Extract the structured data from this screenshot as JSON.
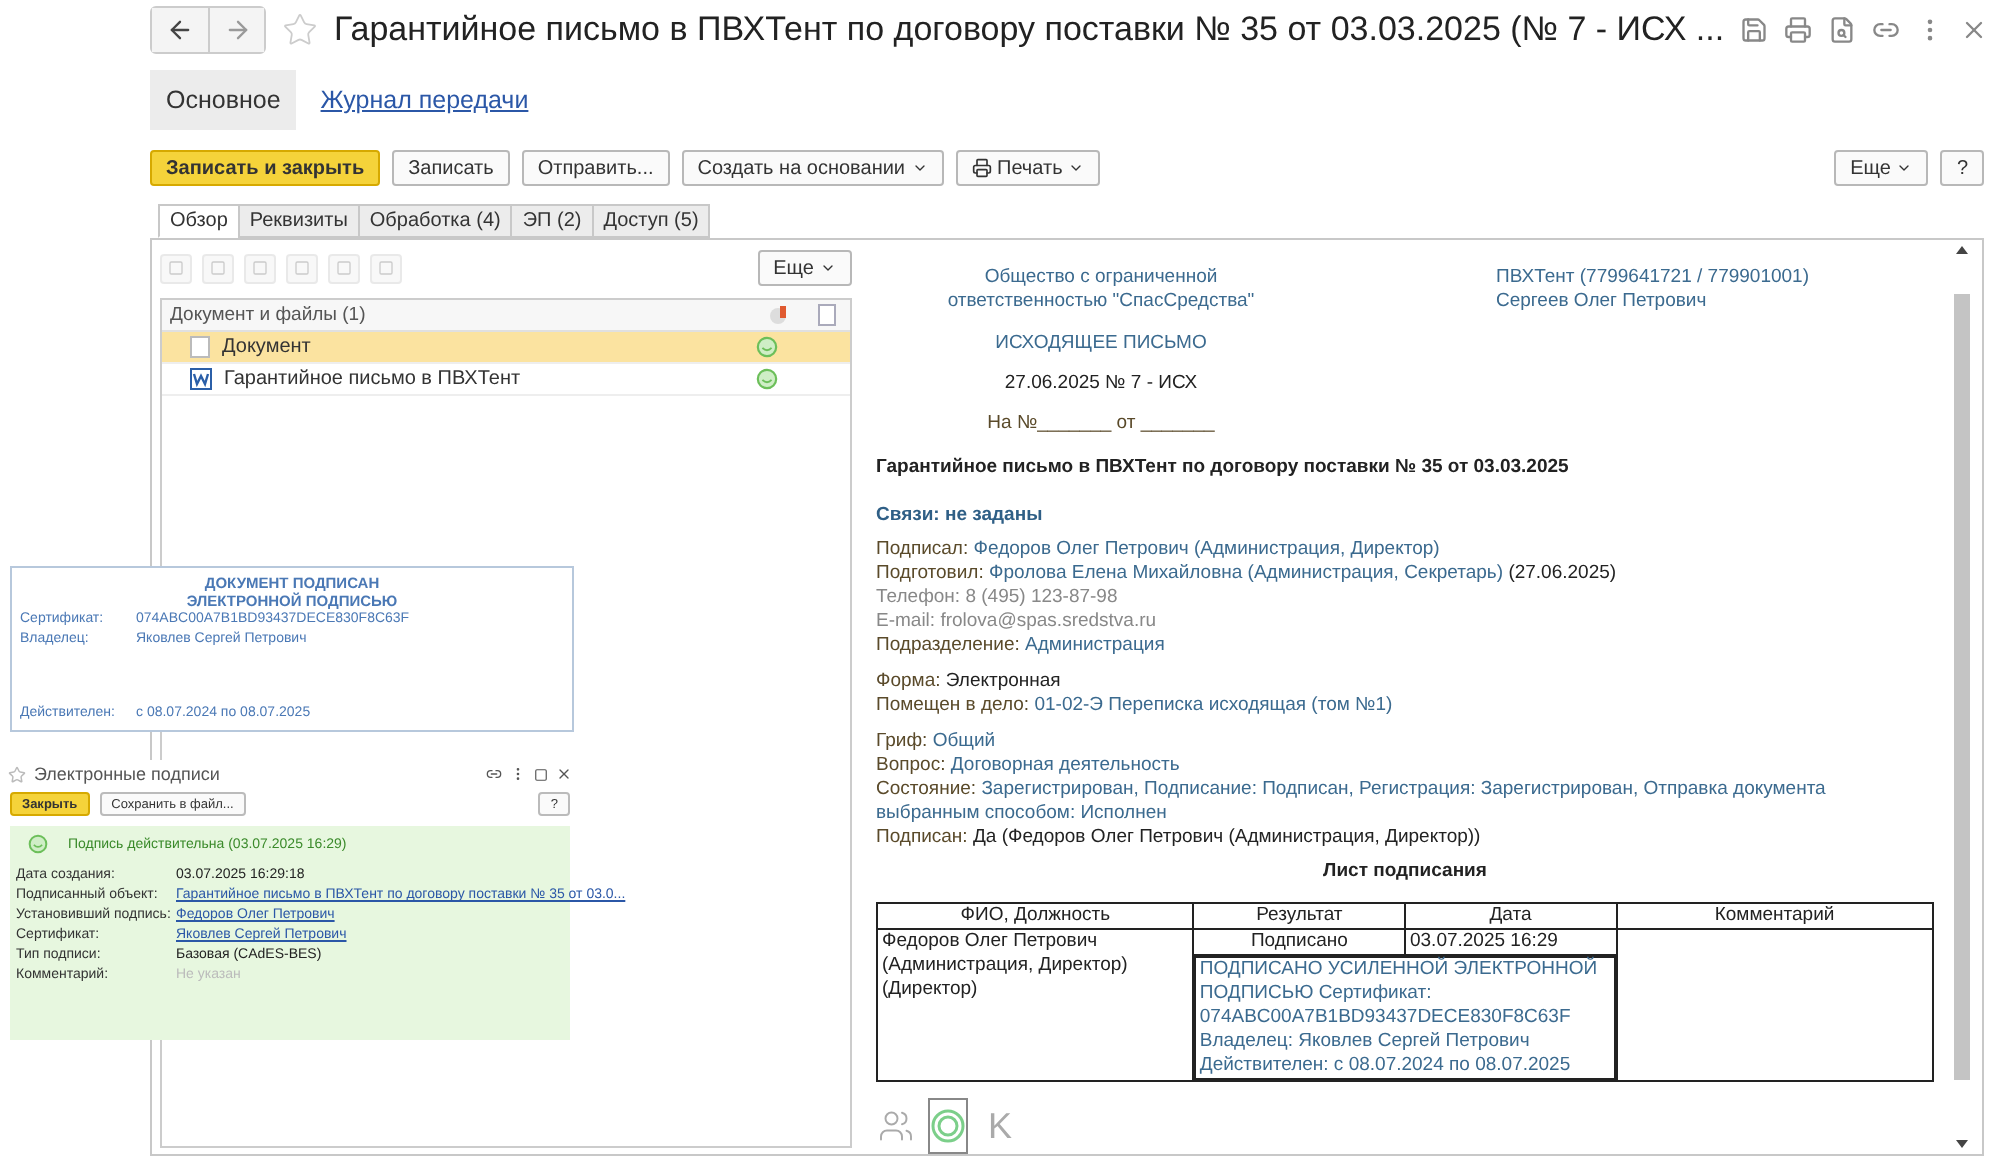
{
  "window": {
    "title": "Гарантийное письмо в ПВХТент по договору поставки № 35 от 03.03.2025 (№ 7 - ИСХ ..."
  },
  "sections": [
    {
      "label": "Основное",
      "selected": true
    },
    {
      "label": "Журнал передачи",
      "selected": false
    }
  ],
  "toolbar": {
    "buttons": [
      {
        "label": "Записать и закрыть",
        "primary": true,
        "dropdown": false,
        "kind": "text"
      },
      {
        "label": "Записать",
        "primary": false,
        "dropdown": false,
        "kind": "text"
      },
      {
        "label": "Отправить...",
        "primary": false,
        "dropdown": false,
        "kind": "text"
      },
      {
        "label": "Создать на основании",
        "primary": false,
        "dropdown": true,
        "kind": "text"
      },
      {
        "label": "Печать",
        "primary": false,
        "dropdown": true,
        "kind": "print"
      }
    ],
    "more": "Еще",
    "help": "?"
  },
  "tabs": [
    {
      "label": "Обзор",
      "selected": true
    },
    {
      "label": "Реквизиты",
      "selected": false
    },
    {
      "label": "Обработка (4)",
      "selected": false
    },
    {
      "label": "ЭП (2)",
      "selected": false
    },
    {
      "label": "Доступ (5)",
      "selected": false
    }
  ],
  "files": {
    "tools_disabled": true,
    "more": "Еще",
    "header": "Документ и файлы (1)",
    "rows": [
      {
        "label": "Документ",
        "kind": "document",
        "selected": true
      },
      {
        "label": "Гарантийное письмо в ПВХТент",
        "kind": "word",
        "selected": false
      }
    ]
  },
  "letter": {
    "sender": [
      "Общество с ограниченной",
      "ответственностью \"СпасСредства\""
    ],
    "recipient": [
      "ПВХТент (7799641721 / 779901001)",
      "Сергеев Олег Петрович"
    ],
    "kind_label": "ИСХОДЯЩЕЕ ПИСЬМО",
    "number": "27.06.2025 № 7 - ИСХ",
    "reply_to": "На №_______ от _______",
    "subject": "Гарантийное письмо в ПВХТент по договору поставки № 35 от 03.03.2025",
    "links_header": "Связи: не заданы",
    "groups": [
      [
        {
          "label": "Подписал:",
          "value": "Федоров Олег Петрович (Администрация, Директор)",
          "kind": "link"
        },
        {
          "label": "Подготовил:",
          "value": "Фролова Елена Михайловна (Администрация, Секретарь)",
          "suffix": "(27.06.2025)",
          "kind": "link"
        },
        {
          "label": "Телефон:",
          "value": "8 (495) 123-87-98",
          "kind": "muted"
        },
        {
          "label": "E-mail:",
          "value": "frolova@spas.sredstva.ru",
          "kind": "muted"
        },
        {
          "label": "Подразделение:",
          "value": "Администрация",
          "kind": "link"
        }
      ],
      [
        {
          "label": "Форма:",
          "value": "Электронная",
          "kind": "plain"
        },
        {
          "label": "Помещен в дело:",
          "value": "01-02-Э Переписка исходящая (том №1)",
          "kind": "link"
        }
      ],
      [
        {
          "label": "Гриф:",
          "value": "Общий",
          "kind": "link"
        },
        {
          "label": "Вопрос:",
          "value": "Договорная деятельность",
          "kind": "link"
        },
        {
          "label": "Состояние:",
          "value": "Зарегистрирован, Подписание: Подписан, Регистрация: Зарегистрирован, Отправка документа выбранным способом: Исполнен",
          "kind": "link"
        },
        {
          "label": "Подписан:",
          "value": "Да (Федоров Олег Петрович (Администрация, Директор))",
          "kind": "plain"
        }
      ]
    ],
    "sheet_title": "Лист подписания",
    "sheet": {
      "columns": [
        "ФИО, Должность",
        "Результат",
        "Дата",
        "Комментарий"
      ],
      "rows": [
        {
          "person": "Федоров Олег Петрович (Администрация, Директор) (Директор)",
          "result": "Подписано",
          "date": "03.07.2025 16:29",
          "stamp": [
            "ПОДПИСАНО УСИЛЕННОЙ ЭЛЕКТРОННОЙ",
            "ПОДПИСЬЮ Сертификат:",
            "074ABC00A7B1BD93437DECE830F8C63F",
            "Владелец: Яковлев Сергей Петрович",
            "Действителен: с 08.07.2024 по 08.07.2025"
          ]
        }
      ]
    }
  },
  "bottom_icons": [
    {
      "kind": "people",
      "selected": false
    },
    {
      "kind": "stamp",
      "selected": true
    },
    {
      "kind": "letter",
      "label": "K",
      "selected": false
    }
  ],
  "stamp": {
    "title": [
      "ДОКУМЕНТ ПОДПИСАН",
      "ЭЛЕКТРОННОЙ ПОДПИСЬЮ"
    ],
    "rows": [
      {
        "label": "Сертификат:",
        "value": "074ABC00A7B1BD93437DECE830F8C63F"
      },
      {
        "label": "Владелец:",
        "value": "Яковлев Сергей Петрович"
      }
    ],
    "validity": {
      "label": "Действителен:",
      "value": "с 08.07.2024 по 08.07.2025"
    }
  },
  "signatures": {
    "title": "Электронные подписи",
    "close": "Закрыть",
    "save": "Сохранить в файл...",
    "help": "?",
    "status": "Подпись действительна (03.07.2025 16:29)",
    "fields": [
      {
        "label": "Дата создания:",
        "value": "03.07.2025 16:29:18",
        "kind": "plain"
      },
      {
        "label": "Подписанный объект:",
        "value": "Гарантийное письмо в ПВХТент по договору поставки № 35 от 03.0...",
        "kind": "link"
      },
      {
        "label": "Установивший подпись:",
        "value": "Федоров Олег Петрович",
        "kind": "link"
      },
      {
        "label": "Сертификат:",
        "value": "Яковлев Сергей Петрович",
        "kind": "link"
      },
      {
        "label": "Тип подписи:",
        "value": "Базовая (CAdES-BES)",
        "kind": "plain"
      },
      {
        "label": "Комментарий:",
        "placeholder": "Не указан",
        "kind": "empty"
      }
    ]
  }
}
